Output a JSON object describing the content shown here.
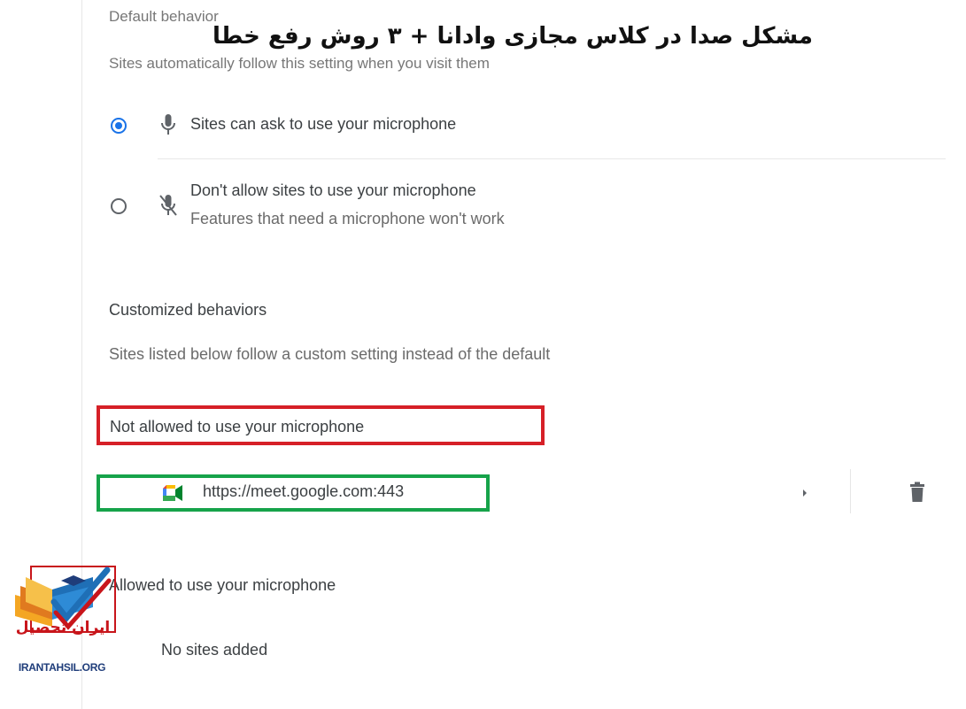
{
  "overlay": {
    "title": "مشکل صدا در کلاس مجازی وادانا + ۳ روش رفع خطا"
  },
  "default_behavior": {
    "heading": "Default behavior",
    "description": "Sites automatically follow this setting when you visit them",
    "options": [
      {
        "label": "Sites can ask to use your microphone",
        "sublabel": "",
        "selected": true,
        "icon": "microphone-icon"
      },
      {
        "label": "Don't allow sites to use your microphone",
        "sublabel": "Features that need a microphone won't work",
        "selected": false,
        "icon": "microphone-off-icon"
      }
    ]
  },
  "customized_behaviors": {
    "heading": "Customized behaviors",
    "description": "Sites listed below follow a custom setting instead of the default",
    "not_allowed": {
      "heading": "Not allowed to use your microphone",
      "sites": [
        {
          "url": "https://meet.google.com:443",
          "icon": "google-meet-icon"
        }
      ]
    },
    "allowed": {
      "heading": "Allowed to use your microphone",
      "empty_text": "No sites added"
    }
  },
  "watermark": {
    "name_fa": "ایران تحصیل",
    "domain": "IRANTAHSIL.ORG"
  },
  "colors": {
    "accent": "#1a73e8",
    "highlight_red": "#d62027",
    "highlight_green": "#16a34a",
    "logo_red": "#c8151b",
    "logo_blue": "#1f3d7a"
  }
}
